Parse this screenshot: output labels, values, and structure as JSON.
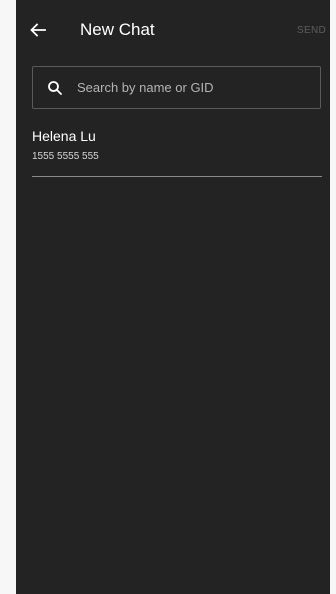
{
  "app_bar": {
    "back_icon": "arrow-left-icon",
    "title": "New Chat",
    "send_label": "SEND"
  },
  "search": {
    "icon": "search-icon",
    "placeholder": "Search by name or GID",
    "value": ""
  },
  "contacts": [
    {
      "name": "Helena Lu",
      "number": "1555 5555 555"
    }
  ],
  "colors": {
    "background": "#232323",
    "text_primary": "#ffffff",
    "send_disabled": "#5d5d5d",
    "divider": "#8a8a8a",
    "search_border": "#5a5a5a"
  }
}
